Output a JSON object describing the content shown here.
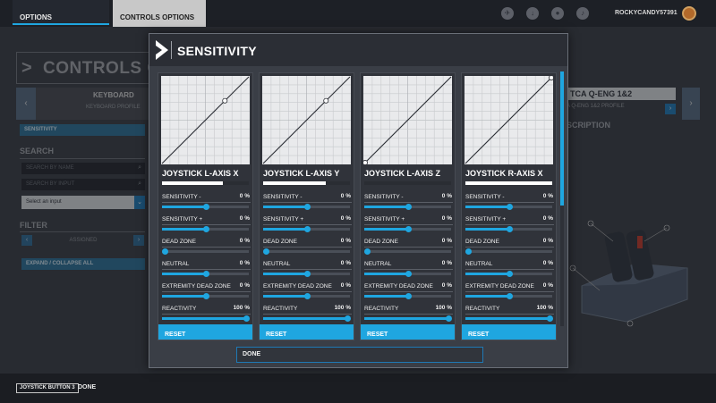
{
  "top": {
    "tabs": [
      "OPTIONS",
      "CONTROLS OPTIONS"
    ],
    "icons": [
      "sim-icon",
      "download-icon",
      "profile-icon",
      "notifications-icon"
    ],
    "username": "ROCKYCANDY57391"
  },
  "background": {
    "title": "CONTROLS O",
    "device_label": "KEYBOARD",
    "device_sub": "KEYBOARD PROFILE",
    "sensitivity_item": "SENSITIVITY",
    "search_heading": "SEARCH",
    "search_by_name_placeholder": "SEARCH BY NAME",
    "search_by_input_placeholder": "SEARCH BY INPUT",
    "select_input": "Select an input",
    "filter_heading": "FILTER",
    "filter_value": "ASSIGNED",
    "expand_collapse": "EXPAND / COLLAPSE ALL",
    "right_device": "TCA Q-ENG 1&2",
    "right_device_sub": "A Q-ENG 1&2 PROFILE",
    "description_heading": "SCRIPTION"
  },
  "modal": {
    "title": "SENSITIVITY",
    "reset_label": "RESET",
    "done_label": "DONE",
    "setting_names": [
      "SENSITIVITY -",
      "SENSITIVITY +",
      "DEAD ZONE",
      "NEUTRAL",
      "EXTREMITY DEAD ZONE",
      "REACTIVITY"
    ],
    "panels": [
      {
        "axis": "JOYSTICK L-AXIS X",
        "axis_level": 0.7,
        "curve_point": [
          0.72,
          0.72
        ],
        "values": [
          "0 %",
          "0 %",
          "0 %",
          "0 %",
          "0 %",
          "100 %"
        ],
        "levels": [
          0.5,
          0.5,
          0,
          0.5,
          0.5,
          1
        ]
      },
      {
        "axis": "JOYSTICK L-AXIS Y",
        "axis_level": 0.72,
        "curve_point": [
          0.72,
          0.72
        ],
        "values": [
          "0 %",
          "0 %",
          "0 %",
          "0 %",
          "0 %",
          "100 %"
        ],
        "levels": [
          0.5,
          0.5,
          0,
          0.5,
          0.5,
          1
        ]
      },
      {
        "axis": "JOYSTICK L-AXIS Z",
        "axis_level": 0.0,
        "curve_point": [
          0.02,
          0.02
        ],
        "values": [
          "0 %",
          "0 %",
          "0 %",
          "0 %",
          "0 %",
          "100 %"
        ],
        "levels": [
          0.5,
          0.5,
          0,
          0.5,
          0.5,
          1
        ]
      },
      {
        "axis": "JOYSTICK R-AXIS X",
        "axis_level": 1.0,
        "curve_point": [
          0.98,
          0.98
        ],
        "values": [
          "0 %",
          "0 %",
          "0 %",
          "0 %",
          "0 %",
          "100 %"
        ],
        "levels": [
          0.5,
          0.5,
          0,
          0.5,
          0.5,
          1
        ]
      }
    ]
  },
  "footer": {
    "key": "JOYSTICK BUTTON 3",
    "action": "DONE"
  },
  "colors": {
    "accent": "#1fa6e0",
    "panel": "#30333a",
    "graph_bg": "#e9eaec"
  }
}
